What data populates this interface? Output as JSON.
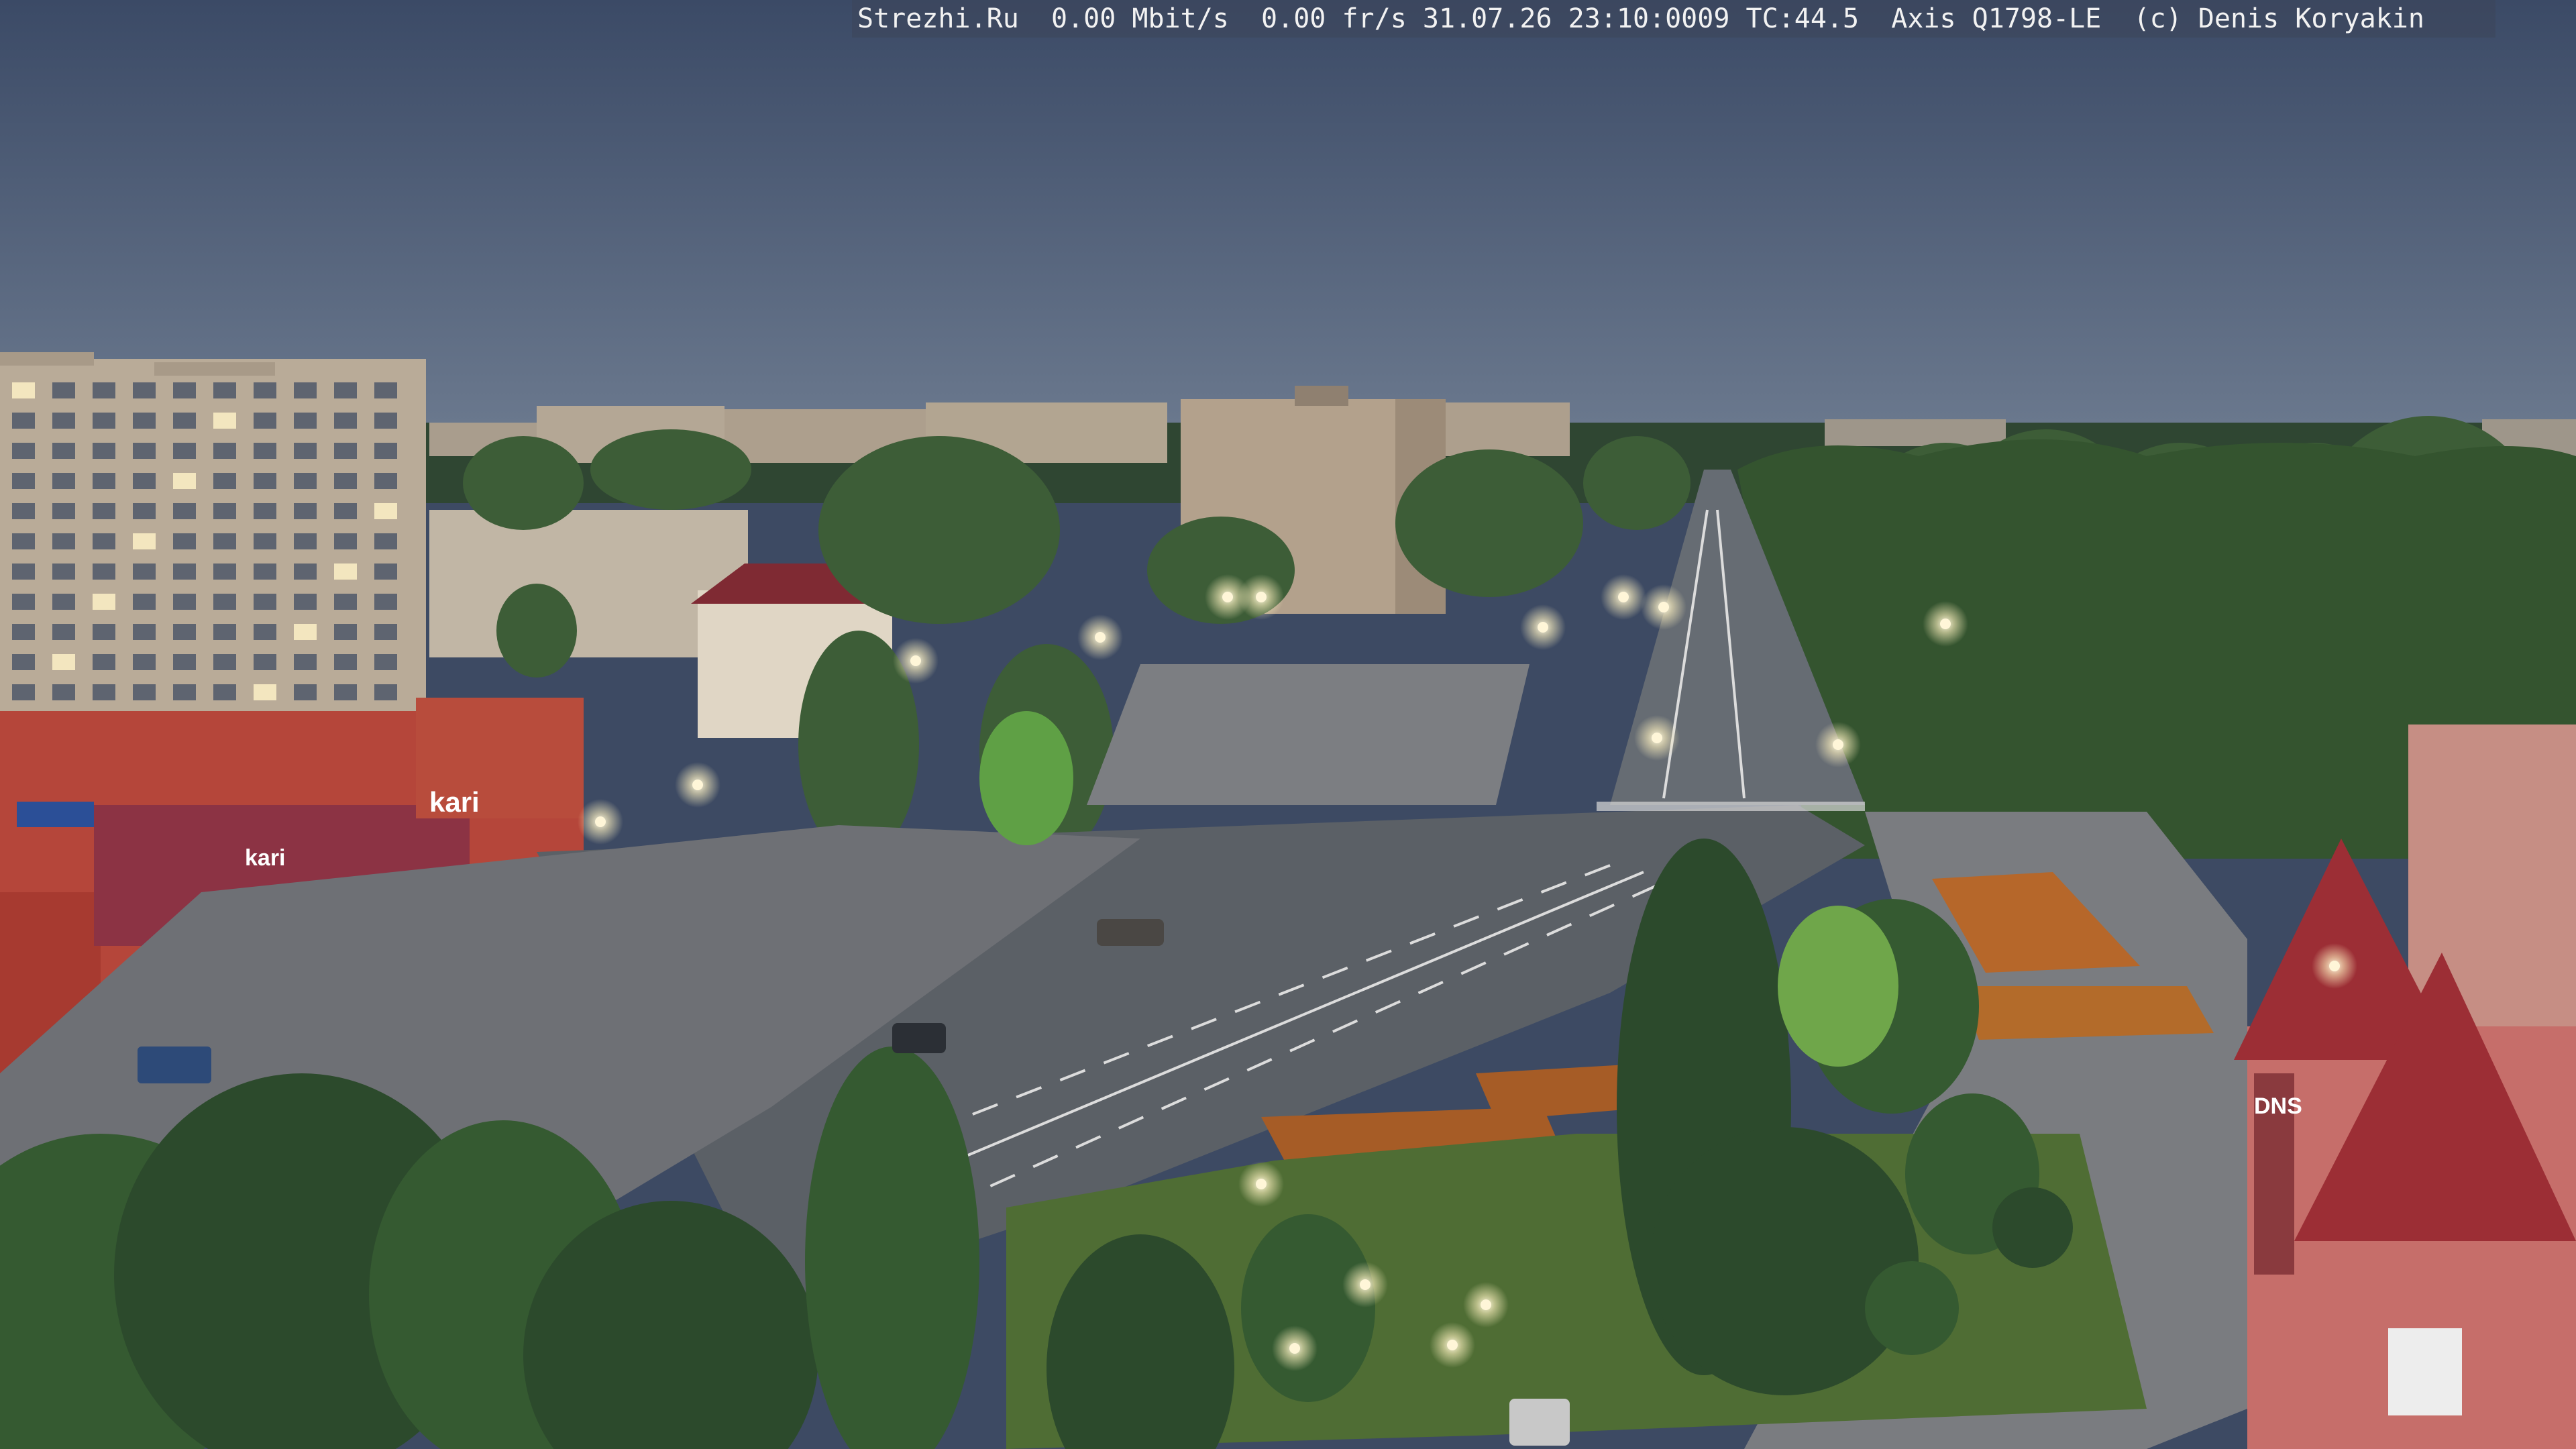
{
  "overlay": {
    "text": "Strezhi.Ru  0.00 Mbit/s  0.00 fr/s 31.07.26 23:10:0009 TC:44.5  Axis Q1798-LE  (c) Denis Koryakin"
  },
  "signs": {
    "store_kari_1": "kari",
    "store_kari_2": "kari",
    "store_dns": "DNS"
  },
  "palette": {
    "sky_top": "#3b4a66",
    "sky_bottom": "#6c7a8f",
    "road": "#5d6268",
    "plaza": "#7a7c80",
    "tree_dark": "#2c4a2c",
    "tree_mid": "#3d5d37",
    "grass": "#5a7a3a",
    "building_panel": "#b9ab98",
    "building_red": "#b5463a",
    "roof_red": "#9c2e35",
    "lamp": "#fff6d8"
  }
}
